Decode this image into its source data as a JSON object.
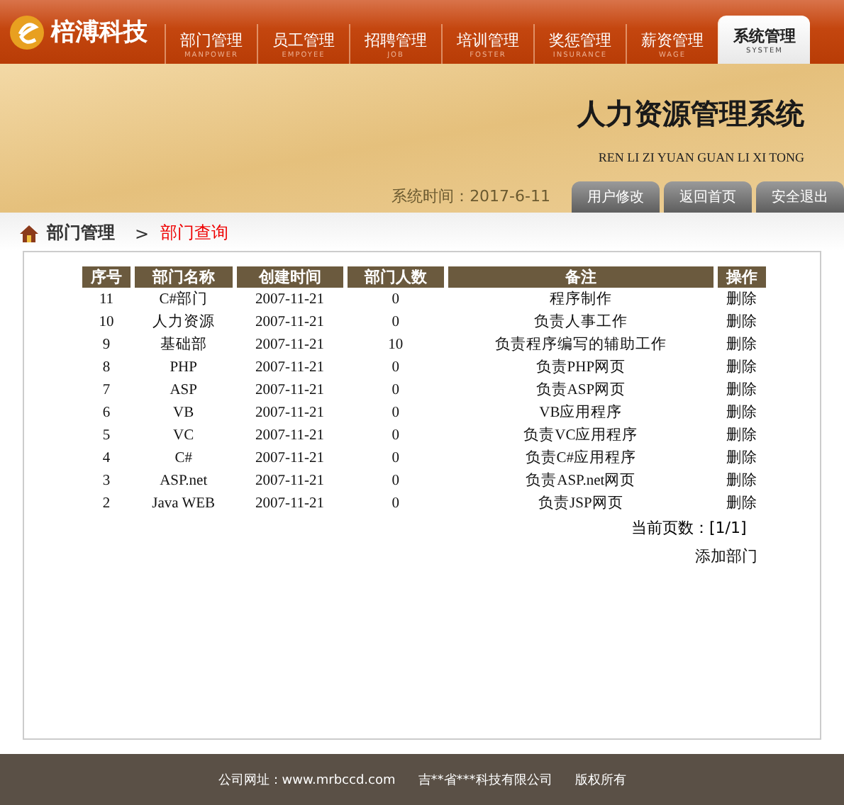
{
  "logo": {
    "text": "棓溥科技"
  },
  "nav": [
    {
      "label": "部门管理",
      "sub": "MANPOWER",
      "selected": false
    },
    {
      "label": "员工管理",
      "sub": "EMPOYEE",
      "selected": false
    },
    {
      "label": "招聘管理",
      "sub": "JOB",
      "selected": false
    },
    {
      "label": "培训管理",
      "sub": "FOSTER",
      "selected": false
    },
    {
      "label": "奖惩管理",
      "sub": "INSURANCE",
      "selected": false
    },
    {
      "label": "薪资管理",
      "sub": "WAGE",
      "selected": false
    },
    {
      "label": "系统管理",
      "sub": "SYSTEM",
      "selected": true
    }
  ],
  "banner": {
    "title": "人力资源管理系统",
    "subtitle": "REN LI ZI YUAN GUAN LI XI TONG",
    "time_label": "系统时间：",
    "time": "2017-6-11",
    "buttons": [
      "用户修改",
      "返回首页",
      "安全退出"
    ]
  },
  "breadcrumb": {
    "parent": "部门管理",
    "separator": ">",
    "current": "部门查询"
  },
  "table": {
    "columns": [
      "序号",
      "部门名称",
      "创建时间",
      "部门人数",
      "备注",
      "操作"
    ],
    "rows": [
      [
        "11",
        "C#部门",
        "2007-11-21",
        "0",
        "程序制作",
        "删除"
      ],
      [
        "10",
        "人力资源",
        "2007-11-21",
        "0",
        "负责人事工作",
        "删除"
      ],
      [
        "9",
        "基础部",
        "2007-11-21",
        "10",
        "负责程序编写的辅助工作",
        "删除"
      ],
      [
        "8",
        "PHP",
        "2007-11-21",
        "0",
        "负责PHP网页",
        "删除"
      ],
      [
        "7",
        "ASP",
        "2007-11-21",
        "0",
        "负责ASP网页",
        "删除"
      ],
      [
        "6",
        "VB",
        "2007-11-21",
        "0",
        "VB应用程序",
        "删除"
      ],
      [
        "5",
        "VC",
        "2007-11-21",
        "0",
        "负责VC应用程序",
        "删除"
      ],
      [
        "4",
        "C#",
        "2007-11-21",
        "0",
        "负责C#应用程序",
        "删除"
      ],
      [
        "3",
        "ASP.net",
        "2007-11-21",
        "0",
        "负责ASP.net网页",
        "删除"
      ],
      [
        "2",
        "Java WEB",
        "2007-11-21",
        "0",
        "负责JSP网页",
        "删除"
      ]
    ]
  },
  "pager": {
    "label": "当前页数：",
    "value": "[1/1]"
  },
  "add_link": "添加部门",
  "footer": {
    "site": "公司网址：www.mrbccd.com",
    "company": "吉**省***科技有限公司",
    "rights": "版权所有"
  }
}
